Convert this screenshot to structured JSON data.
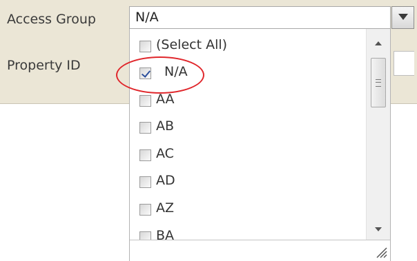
{
  "filters": {
    "access_group_label": "Access Group",
    "property_id_label": "Property ID"
  },
  "access_group_combo": {
    "value": "N/A"
  },
  "dropdown": {
    "items": [
      {
        "label": "(Select All)",
        "checked": false
      },
      {
        "label": "N/A",
        "checked": true
      },
      {
        "label": "AA",
        "checked": false
      },
      {
        "label": "AB",
        "checked": false
      },
      {
        "label": "AC",
        "checked": false
      },
      {
        "label": "AD",
        "checked": false
      },
      {
        "label": "AZ",
        "checked": false
      },
      {
        "label": "BA",
        "checked": false
      }
    ]
  },
  "colors": {
    "panel_background": "#ebe6d6",
    "checkbox_tick": "#2b4e9b",
    "annotation_circle": "#e0262b"
  }
}
